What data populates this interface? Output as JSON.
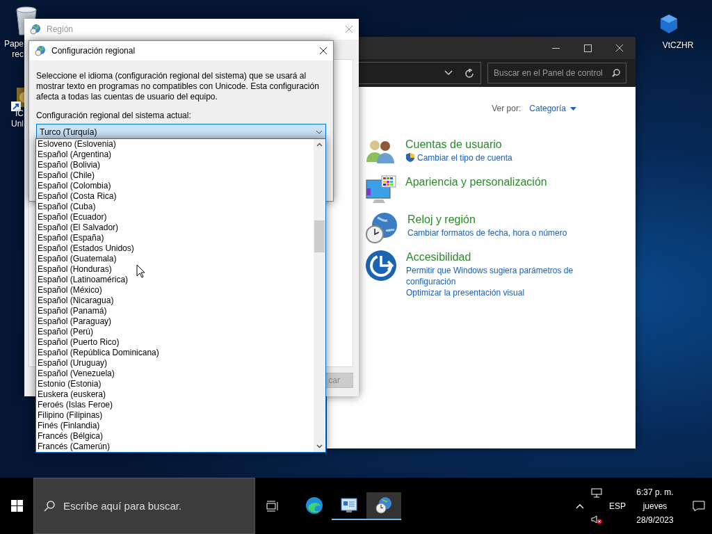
{
  "desktop": {
    "icons": [
      {
        "kind": "recycle-bin",
        "lines": [
          "Pape",
          "rec"
        ]
      },
      {
        "kind": "shortcut",
        "lines": [
          "IC",
          "Unl"
        ]
      },
      {
        "kind": "cube",
        "lines": [
          "VtCZHR"
        ]
      }
    ]
  },
  "control_panel": {
    "search": {
      "placeholder": "Buscar en el Panel de control"
    },
    "view_by": {
      "label": "Ver por:",
      "value": "Categoría"
    },
    "categories": [
      {
        "kind": "users",
        "title": "Cuentas de usuario",
        "links": [
          {
            "text": "Cambiar el tipo de cuenta",
            "shield": true
          }
        ]
      },
      {
        "kind": "appearance",
        "title": "Apariencia y personalización"
      },
      {
        "kind": "clock",
        "title": "Reloj y región",
        "links": [
          {
            "text": "Cambiar formatos de fecha, hora o número",
            "shield": false
          }
        ]
      },
      {
        "kind": "access",
        "title": "Accesibilidad",
        "links": [
          {
            "text": "Permitir que Windows sugiera parámetros de configuración",
            "shield": false
          },
          {
            "text": "Optimizar la presentación visual",
            "shield": false
          }
        ]
      }
    ]
  },
  "region_window": {
    "title": "Región",
    "button": "car"
  },
  "locale_dialog": {
    "title": "Configuración regional",
    "description": "Seleccione el idioma (configuración regional del sistema) que se usará al mostrar texto en programas no compatibles con Unicode. Esta configuración afecta a todas las cuentas de usuario del equipo.",
    "label": "Configuración regional del sistema actual:",
    "value": "Turco (Turquía)",
    "options": [
      "Esloveno (Eslovenia)",
      "Español (Argentina)",
      "Español (Bolivia)",
      "Español (Chile)",
      "Español (Colombia)",
      "Español (Costa Rica)",
      "Español (Cuba)",
      "Español (Ecuador)",
      "Español (El Salvador)",
      "Español (España)",
      "Español (Estados Unidos)",
      "Español (Guatemala)",
      "Español (Honduras)",
      "Español (Latinoamérica)",
      "Español (México)",
      "Español (Nicaragua)",
      "Español (Panamá)",
      "Español (Paraguay)",
      "Español (Perú)",
      "Español (Puerto Rico)",
      "Español (República Dominicana)",
      "Español (Uruguay)",
      "Español (Venezuela)",
      "Estonio (Estonia)",
      "Euskera (euskera)",
      "Feroés (Islas Feroe)",
      "Filipino (Filipinas)",
      "Finés (Finlandia)",
      "Francés (Bélgica)",
      "Francés (Camerún)"
    ]
  },
  "taskbar": {
    "search": {
      "placeholder": "Escribe aquí para buscar."
    },
    "apps": [
      {
        "kind": "edge",
        "running": false,
        "active": false
      },
      {
        "kind": "control-panel",
        "running": true,
        "active": false
      },
      {
        "kind": "region",
        "running": true,
        "active": true
      }
    ],
    "language": "ESP",
    "time": "6:37 p. m.",
    "day": "jueves",
    "date": "28/9/2023"
  }
}
